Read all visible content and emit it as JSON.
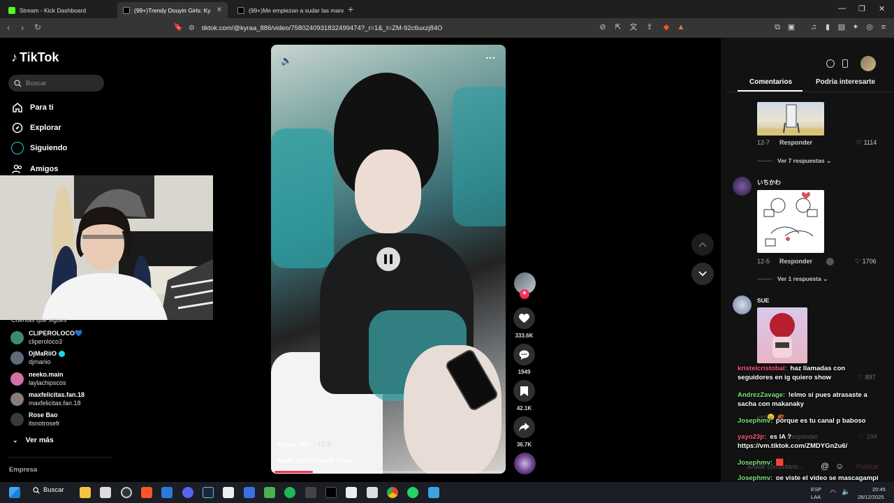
{
  "browser": {
    "tabs": [
      {
        "title": "Stream - Kick Dashboard",
        "active": false
      },
      {
        "title": "(99+)Trendy Douyin Girls: Ky",
        "active": true
      },
      {
        "title": "(99+)Me empiezan a sudar las mano",
        "active": false
      }
    ],
    "new_tab": "+",
    "url": "tiktok.com/@kyraa_886/video/7580240931832499474?_r=1&_t=ZM-92c6uxzj84O"
  },
  "sidebar": {
    "logo": "TikTok",
    "search_placeholder": "Buscar",
    "nav": [
      {
        "label": "Para ti",
        "icon": "home-icon"
      },
      {
        "label": "Explorar",
        "icon": "compass-icon"
      },
      {
        "label": "Siguiendo",
        "icon": "following-icon"
      },
      {
        "label": "Amigos",
        "icon": "friends-icon"
      }
    ],
    "following_title": "Cuentas que sigues",
    "accounts": [
      {
        "name": "CLIPEROLOCO💙",
        "handle": "cliperoloco3",
        "color": "#3b8c6e"
      },
      {
        "name": "DjMaRiiO",
        "handle": "djmariio",
        "color": "#5f6b7a"
      },
      {
        "name": "neeko.main",
        "handle": "laylachipscos",
        "color": "#d46fa6"
      },
      {
        "name": "maxfelicitas.fan.18",
        "handle": "maxfelicitas.fan.18",
        "color": "#8a7d78"
      },
      {
        "name": "Rose Bao",
        "handle": "itsnotrosefr",
        "color": "#3a3a3a"
      }
    ],
    "see_more": "Ver más",
    "company": "Empresa"
  },
  "video": {
    "author": "kyraa_886",
    "date": " · 12-5",
    "description": "#cute #girl #douyin #kyra ...",
    "progress": 0.17
  },
  "actions": {
    "likes": "333.6K",
    "comments": "1949",
    "saves": "42.1K",
    "shares": "36.7K"
  },
  "comments_panel": {
    "tabs": [
      "Comentarios",
      "Podría interesarte"
    ],
    "comments": [
      {
        "date": "12-7",
        "reply": "Responder",
        "likes": "1114",
        "replies": "Ver 7 respuestas"
      },
      {
        "user": "いちかわ",
        "date": "12-5",
        "reply": "Responder",
        "likes": "1706",
        "replies": "Ver 1 respuesta"
      },
      {
        "user": "SUE",
        "likes": "897"
      }
    ],
    "ghost_texts": [
      "yes😢 🍂",
      "Responder",
      "194",
      "Añadir comentario...",
      "Publicar"
    ]
  },
  "chat": [
    {
      "user": "kristelcristobal:",
      "text": " haz llamadas con seguidores en ig quiero show",
      "color": "#ff5a7a"
    },
    {
      "user": "AndrezZavage:",
      "text": " !elmo si pues atrasaste a sacha con makanaky",
      "color": "#7ee37e"
    },
    {
      "user": "Josephmv:",
      "text": " porque es tu canal p baboso",
      "color": "#7ee37e"
    },
    {
      "user": "yayo23jr:",
      "text": " es IA ? https://vm.tiktok.com/ZMDYGn2u6/",
      "color": "#ff5a7a"
    },
    {
      "user": "Josephmv:",
      "text": " 🟥",
      "color": "#7ee37e"
    },
    {
      "user": "Josephmv:",
      "text": " oe viste el video se mascagampi jugando en la calle xD",
      "color": "#7ee37e"
    }
  ],
  "taskbar": {
    "search": "Buscar",
    "lang": "ESP",
    "layout": "LAA",
    "time": "20:45",
    "date": "28/12/2025"
  }
}
